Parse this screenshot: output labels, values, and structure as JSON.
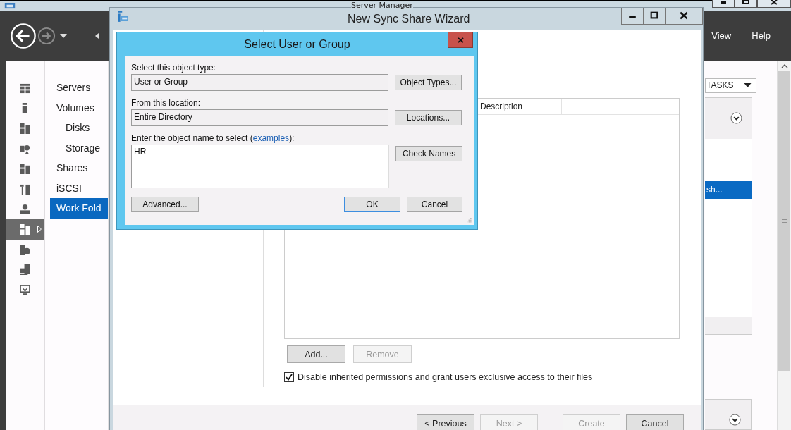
{
  "server_manager": {
    "title": "Server Manager",
    "rail": [
      {
        "selected": false
      },
      {
        "selected": false
      },
      {
        "selected": false
      },
      {
        "selected": false
      },
      {
        "selected": false
      },
      {
        "selected": false
      },
      {
        "selected": false
      },
      {
        "selected": true
      },
      {
        "selected": false
      },
      {
        "selected": false
      },
      {
        "selected": false
      }
    ],
    "nav": [
      {
        "label": "Servers",
        "selected": false
      },
      {
        "label": "Volumes",
        "selected": false,
        "children": [
          {
            "label": "Disks",
            "selected": false
          },
          {
            "label": "Storage",
            "selected": false
          }
        ]
      },
      {
        "label": "Shares",
        "selected": false
      },
      {
        "label": "iSCSI",
        "selected": false
      },
      {
        "label": "Work Fold",
        "selected": true
      }
    ],
    "menu": [
      "View",
      "Help"
    ],
    "tasks_button": "TASKS",
    "tile_rows": [
      {
        "label": "sh...",
        "selected": true
      }
    ]
  },
  "wizard": {
    "title": "New Sync Share Wizard",
    "table": {
      "columns": [
        "Description"
      ]
    },
    "list_buttons": [
      {
        "label": "Add...",
        "disabled": false
      },
      {
        "label": "Remove",
        "disabled": true
      }
    ],
    "exclusive_access": {
      "label": "Disable inherited permissions and grant users exclusive access to their files",
      "checked": true
    },
    "footer_buttons": [
      {
        "label": "< Previous",
        "disabled": false
      },
      {
        "label": "Next >",
        "disabled": true
      },
      {
        "label": "Create",
        "disabled": true
      },
      {
        "label": "Cancel",
        "disabled": false
      }
    ]
  },
  "dialog": {
    "title": "Select User or Group",
    "fields": [
      {
        "label": "Select this object type:",
        "value": "User or Group",
        "button": "Object Types..."
      },
      {
        "label": "From this location:",
        "value": "Entire Directory",
        "button": "Locations..."
      }
    ],
    "name_entry": {
      "label_start": "Enter the object name to select (",
      "link": "examples",
      "label_end": "):",
      "value": "HR",
      "button": "Check Names"
    },
    "buttons": [
      {
        "label": "Advanced...",
        "default": false
      },
      {
        "label": "OK",
        "default": true
      },
      {
        "label": "Cancel",
        "default": false
      }
    ]
  }
}
